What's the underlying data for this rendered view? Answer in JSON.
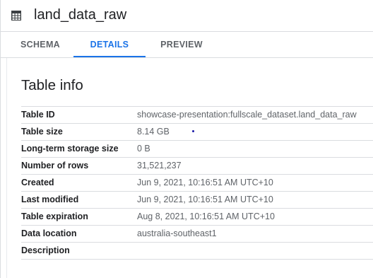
{
  "header": {
    "title": "land_data_raw",
    "icon": "table-icon"
  },
  "tabs": [
    {
      "label": "SCHEMA",
      "active": false
    },
    {
      "label": "DETAILS",
      "active": true
    },
    {
      "label": "PREVIEW",
      "active": false
    }
  ],
  "section": {
    "title": "Table info"
  },
  "table_info": [
    {
      "label": "Table ID",
      "value": "showcase-presentation:fullscale_dataset.land_data_raw"
    },
    {
      "label": "Table size",
      "value": "8.14 GB"
    },
    {
      "label": "Long-term storage size",
      "value": "0 B"
    },
    {
      "label": "Number of rows",
      "value": "31,521,237"
    },
    {
      "label": "Created",
      "value": "Jun 9, 2021, 10:16:51 AM UTC+10"
    },
    {
      "label": "Last modified",
      "value": "Jun 9, 2021, 10:16:51 AM UTC+10"
    },
    {
      "label": "Table expiration",
      "value": "Aug 8, 2021, 10:16:51 AM UTC+10"
    },
    {
      "label": "Data location",
      "value": "australia-southeast1"
    },
    {
      "label": "Description",
      "value": ""
    }
  ],
  "colors": {
    "accent": "#1a73e8",
    "text": "#202124",
    "muted": "#5f6368",
    "divider": "#dadce0"
  }
}
